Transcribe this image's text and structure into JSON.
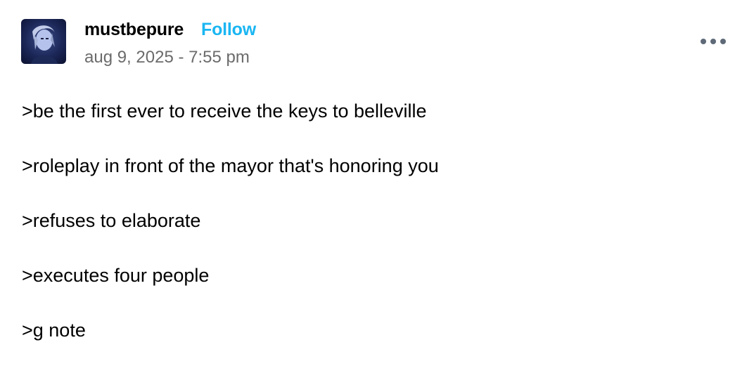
{
  "post": {
    "author": {
      "username": "mustbepure",
      "follow_label": "Follow",
      "avatar_icon": "avatar-photo"
    },
    "timestamp": "aug 9, 2025 - 7:55 pm",
    "menu_icon": "more-options-icon",
    "lines": [
      ">be the first ever to receive the keys to belleville",
      ">roleplay in front of the mayor that's honoring you",
      ">refuses to elaborate",
      ">executes four people",
      ">g note"
    ]
  },
  "colors": {
    "follow": "#1ab6f2",
    "timestamp": "#6b6b6b",
    "menu_dots": "#5e6a78",
    "text": "#000000",
    "background": "#ffffff"
  }
}
